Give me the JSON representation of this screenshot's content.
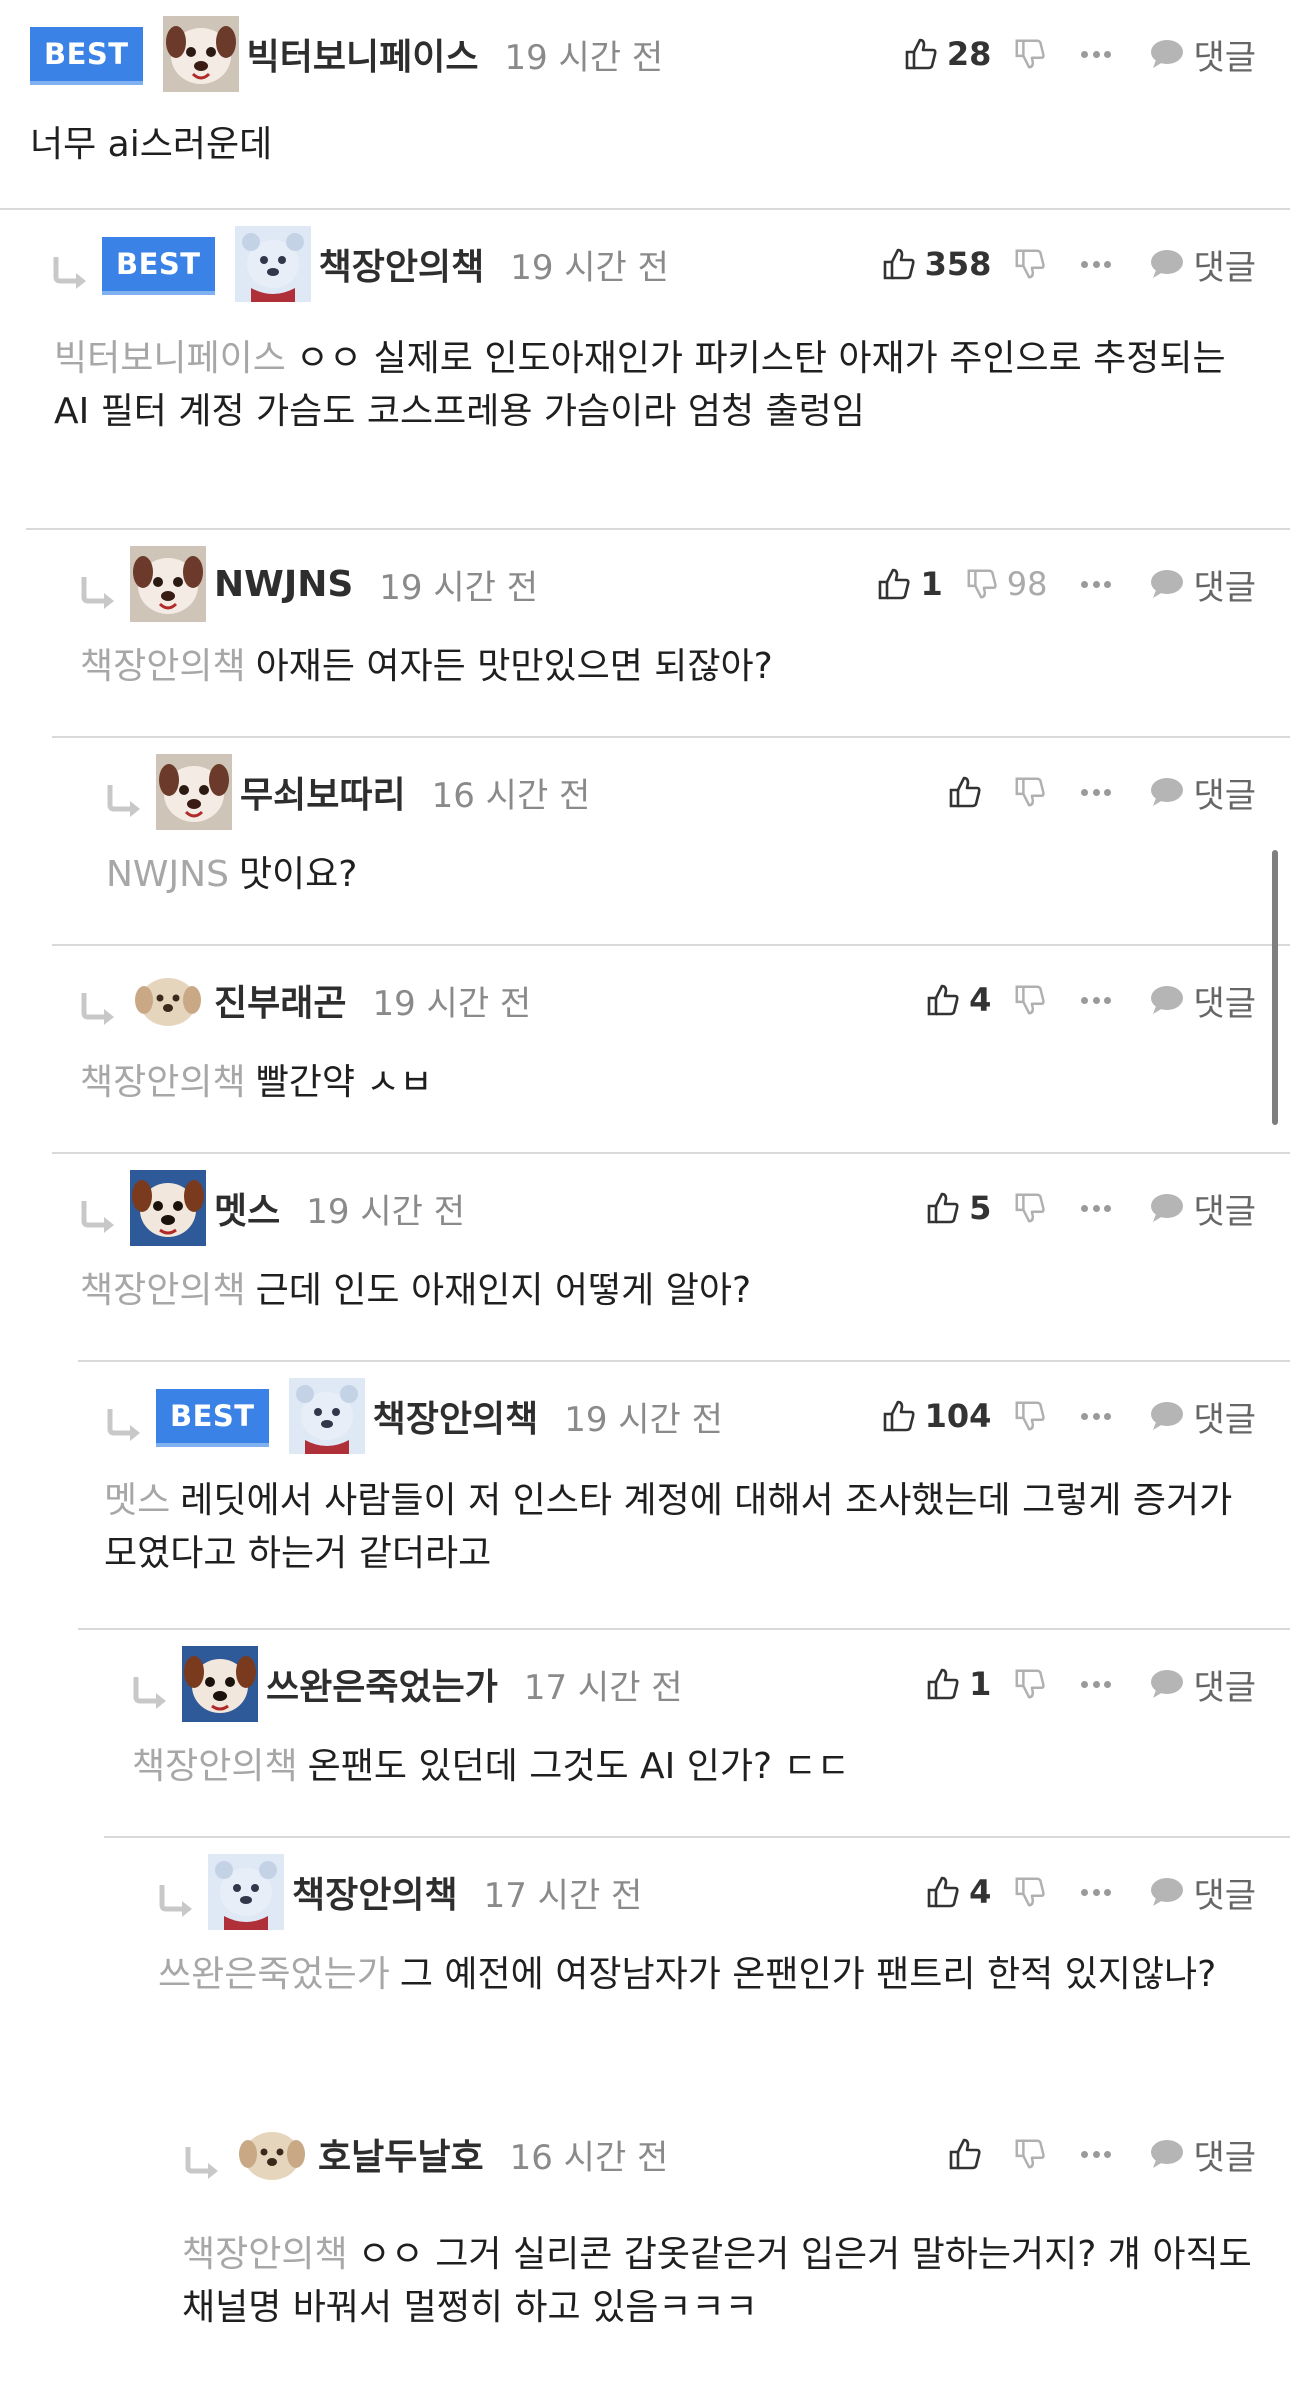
{
  "reply_label": "댓글",
  "best_label": "BEST",
  "colors": {
    "best_badge": "#3b82e6",
    "divider": "#d9d9d9",
    "mention": "#a7a7a7"
  },
  "comments": [
    {
      "nick": "빅터보니페이스",
      "time": "19 시간 전",
      "likes": "28",
      "dislikes": "",
      "mention": "",
      "text": "너무 ai스러운데",
      "avatar": "dog-avatar"
    },
    {
      "nick": "책장안의책",
      "time": "19 시간 전",
      "likes": "358",
      "dislikes": "",
      "mention": "빅터보니페이스",
      "text": "ㅇㅇ 실제로 인도아재인가 파키스탄 아재가 주인으로 추정되는 AI 필터 계정 가슴도 코스프레용 가슴이라 엄청 출렁임",
      "avatar": "bear-avatar"
    },
    {
      "nick": "NWJNS",
      "time": "19 시간 전",
      "likes": "1",
      "dislikes": "98",
      "mention": "책장안의책",
      "text": "아재든 여자든 맛만있으면 되잖아?",
      "avatar": "dog-avatar"
    },
    {
      "nick": "무쇠보따리",
      "time": "16 시간 전",
      "likes": "",
      "dislikes": "",
      "mention": "NWJNS",
      "text": "맛이요?",
      "avatar": "dog-avatar"
    },
    {
      "nick": "진부래곤",
      "time": "19 시간 전",
      "likes": "4",
      "dislikes": "",
      "mention": "책장안의책",
      "text": "빨간약 ㅅㅂ",
      "avatar": "puppy-avatar"
    },
    {
      "nick": "멧스",
      "time": "19 시간 전",
      "likes": "5",
      "dislikes": "",
      "mention": "책장안의책",
      "text": "근데 인도 아재인지 어떻게 알아?",
      "avatar": "dog-dark-avatar"
    },
    {
      "nick": "책장안의책",
      "time": "19 시간 전",
      "likes": "104",
      "dislikes": "",
      "mention": "멧스",
      "text": "레딧에서 사람들이 저 인스타 계정에 대해서 조사했는데 그렇게 증거가 모였다고 하는거 같더라고",
      "avatar": "bear-avatar"
    },
    {
      "nick": "쓰완은죽었는가",
      "time": "17 시간 전",
      "likes": "1",
      "dislikes": "",
      "mention": "책장안의책",
      "text": "온팬도 있던데 그것도 AI 인가? ㄷㄷ",
      "avatar": "dog-dark-avatar"
    },
    {
      "nick": "책장안의책",
      "time": "17 시간 전",
      "likes": "4",
      "dislikes": "",
      "mention": "쓰완은죽었는가",
      "text": "그 예전에 여장남자가 온팬인가 팬트리 한적 있지않나?",
      "avatar": "bear-avatar"
    },
    {
      "nick": "호날두날호",
      "time": "16 시간 전",
      "likes": "",
      "dislikes": "",
      "mention": "책장안의책",
      "text": "ㅇㅇ 그거 실리콘 갑옷같은거 입은거 말하는거지? 걔 아직도 채널명 바꿔서 멀쩡히 하고 있음ㅋㅋㅋ",
      "avatar": "puppy-avatar"
    }
  ]
}
